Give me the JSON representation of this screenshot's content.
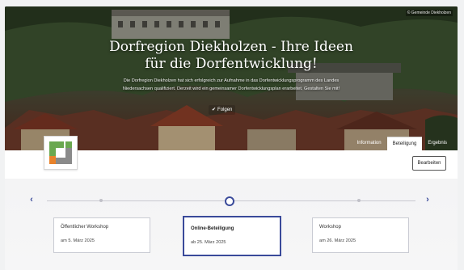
{
  "hero": {
    "photo_credit": "© Gemeinde Diekholzen",
    "title_line1": "Dorfregion Diekholzen - Ihre Ideen",
    "title_line2": "für die Dorfentwicklung!",
    "description": "Die Dorfregion Diekholzen hat sich erfolgreich zur Aufnahme in das Dorfentwicklungsprogramm des Landes Niedersachsen qualifiziert. Derzeit wird ein gemeinsamer Dorfentwicklungsplan erarbeitet. Gestalten Sie mit!",
    "follow_label": "Folgen",
    "follow_icon": "check"
  },
  "tabs": [
    {
      "label": "Information",
      "active": false
    },
    {
      "label": "Beteiligung",
      "active": true
    },
    {
      "label": "Ergebnis",
      "active": false
    }
  ],
  "toolbar": {
    "edit_label": "Bearbeiten"
  },
  "timeline": {
    "cards": [
      {
        "title": "Öffentlicher Workshop",
        "date": "am 5. März 2025",
        "active": false
      },
      {
        "title": "Online-Beteiligung",
        "date": "ab 25. März 2025",
        "active": true
      },
      {
        "title": "Workshop",
        "date": "am 26. März 2025",
        "active": false
      }
    ]
  },
  "colors": {
    "accent": "#3a4a9a",
    "logo_green": "#6aa84f",
    "logo_orange": "#e8822a",
    "logo_grey": "#8a8a8a"
  }
}
